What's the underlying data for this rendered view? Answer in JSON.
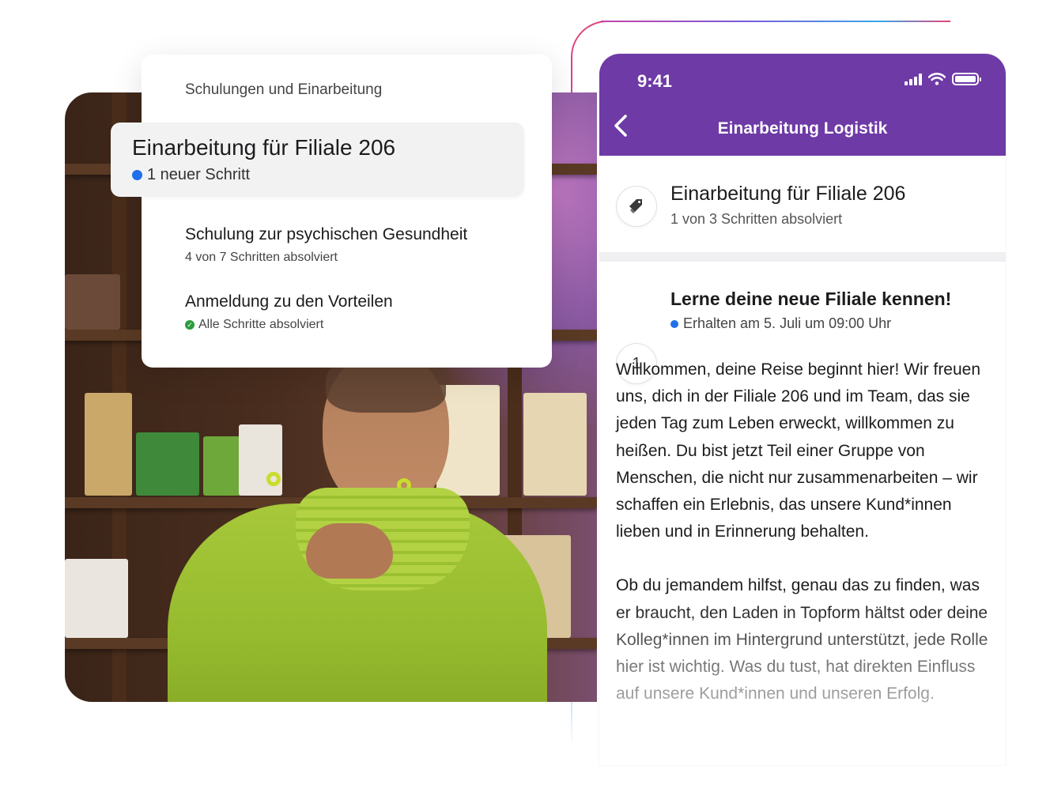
{
  "left_card": {
    "header": "Schulungen und Einarbeitung",
    "selected_course": {
      "title": "Einarbeitung für Filiale 206",
      "status": "1 neuer Schritt"
    },
    "courses": [
      {
        "title": "Schulung zur psychischen Gesundheit",
        "status": "4 von 7 Schritten absolviert"
      },
      {
        "title": "Anmeldung zu den Vorteilen",
        "status": "Alle Schritte absolviert"
      }
    ]
  },
  "phone": {
    "status_bar": {
      "time": "9:41"
    },
    "header": {
      "title": "Einarbeitung Logistik",
      "back_icon": "chevron-left-icon"
    },
    "summary": {
      "icon": "tag-icon",
      "title": "Einarbeitung für Filiale 206",
      "progress": "1 von 3 Schritten absolviert"
    },
    "step": {
      "number": "1",
      "title": "Lerne deine neue Filiale kennen!",
      "received": "Erhalten am 5. Juli um 09:00 Uhr",
      "paragraphs": [
        "Willkommen, deine Reise beginnt hier! Wir freuen uns, dich in der Filiale 206 und im Team, das sie jeden Tag zum Leben erweckt, willkommen zu heißen. Du bist jetzt Teil einer Gruppe von Menschen, die nicht nur zusammenarbeiten – wir schaffen ein Erlebnis, das unsere Kund*innen lieben und in Erinnerung behalten.",
        "Ob du jemandem hilfst, genau das zu finden, was er braucht, den Laden in Topform hältst oder deine Kolleg*innen im Hintergrund unterstützt, jede Rolle hier ist wichtig. Was du tust, hat direkten Einfluss auf unsere Kund*innen und unseren Erfolg."
      ]
    }
  },
  "colors": {
    "header_purple": "#6e3aa6",
    "new_dot_blue": "#1f6feb",
    "complete_green": "#2a9d3a"
  }
}
